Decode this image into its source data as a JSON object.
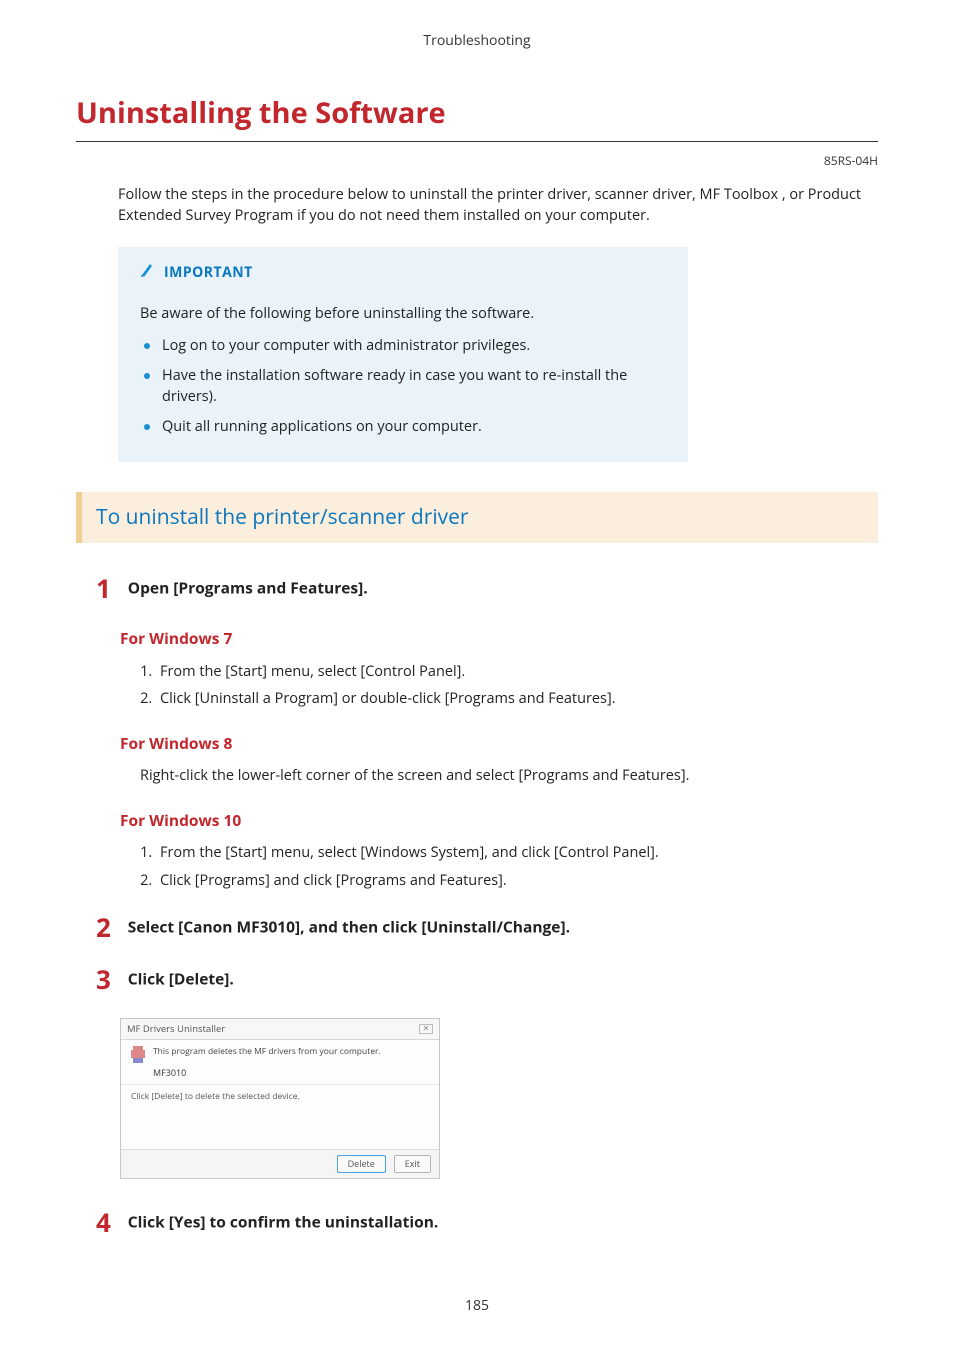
{
  "header": "Troubleshooting",
  "title": "Uninstalling the Software",
  "doc_code": "85RS-04H",
  "intro": "Follow the steps in the procedure below to uninstall the printer driver, scanner driver, MF Toolbox , or Product Extended Survey Program if you do not need them installed on your computer.",
  "important": {
    "label": "IMPORTANT",
    "lead": "Be aware of the following before uninstalling the software.",
    "items": [
      "Log on to your computer with administrator privileges.",
      "Have the installation software ready in case you want to re-install the drivers).",
      "Quit all running applications on your computer."
    ]
  },
  "section_heading": "To uninstall the printer/scanner driver",
  "steps": {
    "s1": {
      "num": "1",
      "text": "Open [Programs and Features].",
      "win7": {
        "head": "For Windows 7",
        "items": [
          "From the [Start] menu, select [Control Panel].",
          "Click [Uninstall a Program] or double-click [Programs and Features]."
        ]
      },
      "win8": {
        "head": "For Windows 8",
        "text": "Right-click the lower-left corner of the screen and select [Programs and Features]."
      },
      "win10": {
        "head": "For Windows 10",
        "items": [
          "From the [Start] menu, select [Windows System], and click [Control Panel].",
          "Click [Programs] and click [Programs and Features]."
        ]
      }
    },
    "s2": {
      "num": "2",
      "text": "Select [Canon MF3010], and then click [Uninstall/Change]."
    },
    "s3": {
      "num": "3",
      "text": "Click [Delete]."
    },
    "s4": {
      "num": "4",
      "text": "Click [Yes] to confirm the uninstallation."
    }
  },
  "dialog": {
    "title": "MF Drivers Uninstaller",
    "msg": "This program deletes the MF drivers from your computer.",
    "model": "MF3010",
    "hint": "Click [Delete] to delete the selected device.",
    "btn_primary": "Delete",
    "btn_secondary": "Exit"
  },
  "page_number": "185"
}
